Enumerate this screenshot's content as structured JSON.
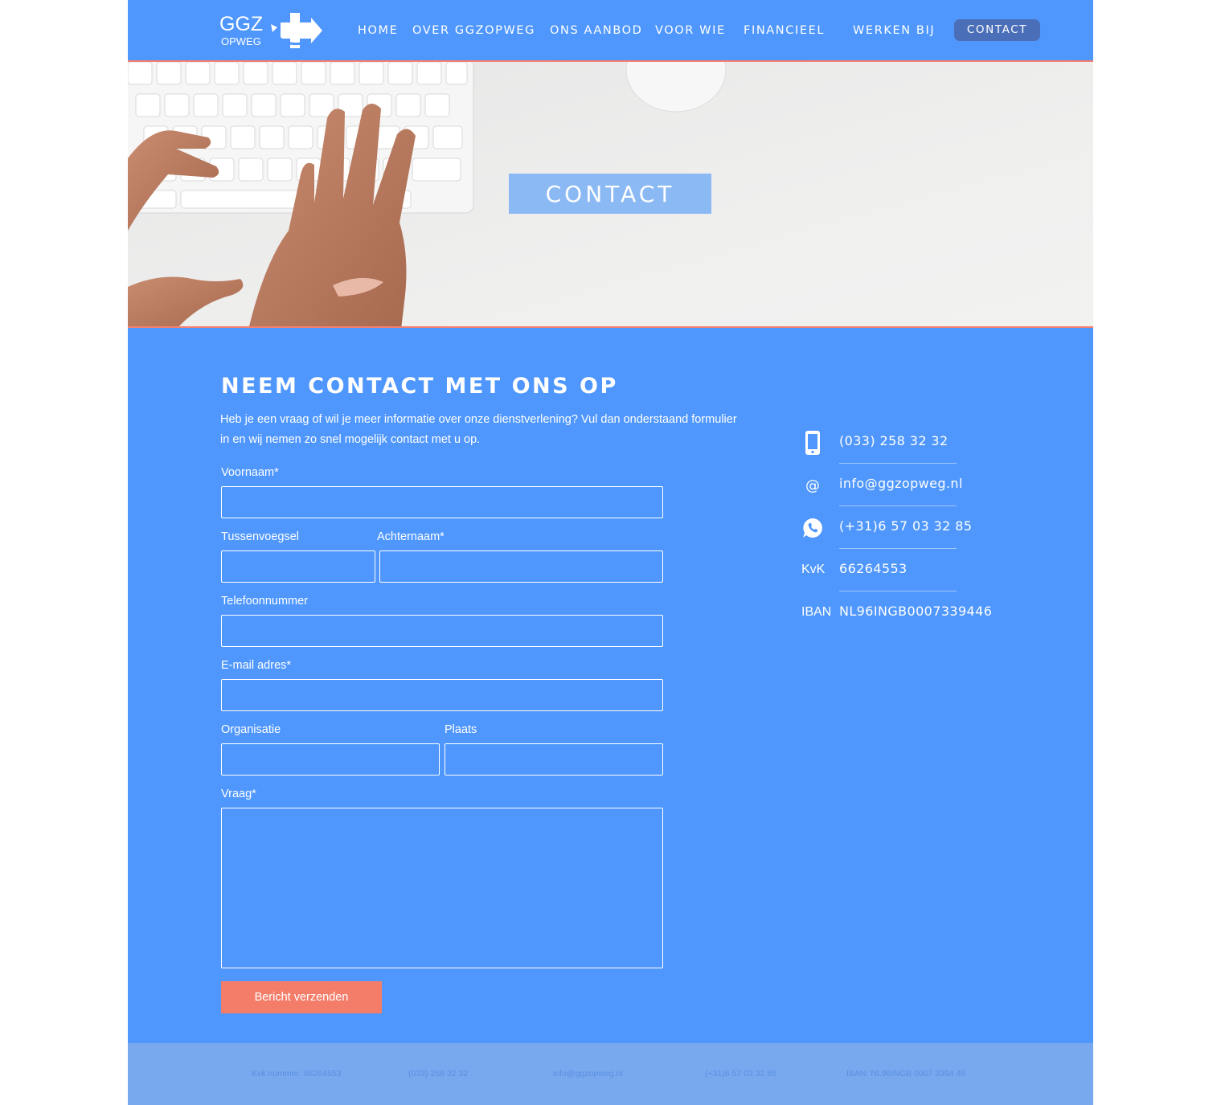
{
  "brand": {
    "logo_top": "GGZ",
    "logo_bottom": "OPWEG"
  },
  "nav": {
    "items": [
      {
        "label": "HOME"
      },
      {
        "label": "OVER GGZOPWEG"
      },
      {
        "label": "ONS AANBOD"
      },
      {
        "label": "VOOR WIE"
      },
      {
        "label": "FINANCIEEL"
      },
      {
        "label": "WERKEN BIJ"
      }
    ],
    "contact_label": "CONTACT"
  },
  "hero": {
    "title": "CONTACT"
  },
  "main": {
    "heading": "NEEM CONTACT MET ONS OP",
    "intro": "Heb je een vraag of wil je meer informatie over onze dienstverlening? Vul dan onderstaand formulier in en wij nemen zo snel mogelijk contact met u op."
  },
  "form": {
    "voornaam_label": "Voornaam*",
    "tussenvoegsel_label": "Tussenvoegsel",
    "achternaam_label": "Achternaam*",
    "telefoon_label": "Telefoonnummer",
    "email_label": "E-mail adres*",
    "organisatie_label": "Organisatie",
    "plaats_label": "Plaats",
    "vraag_label": "Vraag*",
    "voornaam_value": "",
    "tussenvoegsel_value": "",
    "achternaam_value": "",
    "telefoon_value": "",
    "email_value": "",
    "organisatie_value": "",
    "plaats_value": "",
    "vraag_value": "",
    "submit_label": "Bericht verzenden"
  },
  "contact_info": {
    "phone": "(033) 258 32 32",
    "email": "info@ggzopweg.nl",
    "whatsapp": "(+31)6 57 03 32 85",
    "kvk_prefix": "KvK",
    "kvk": "66264553",
    "iban_prefix": "IBAN",
    "iban": "NL96INGB0007339446",
    "icons": [
      "phone-icon",
      "at-icon",
      "whatsapp-icon"
    ]
  },
  "footer": {
    "kvk": "Kvk nummer: 66264553",
    "phone": "(033) 258 32 32",
    "email": "info@ggzopweg.nl",
    "whatsapp": "(+31)6 57 03 32 85",
    "iban": "IBAN: NL96INGB 0007 3394 46"
  },
  "colors": {
    "primary": "#4f97fd",
    "accent": "#f47d6a",
    "contact_button": "#4a6fb8",
    "footer": "#78a9ef"
  }
}
